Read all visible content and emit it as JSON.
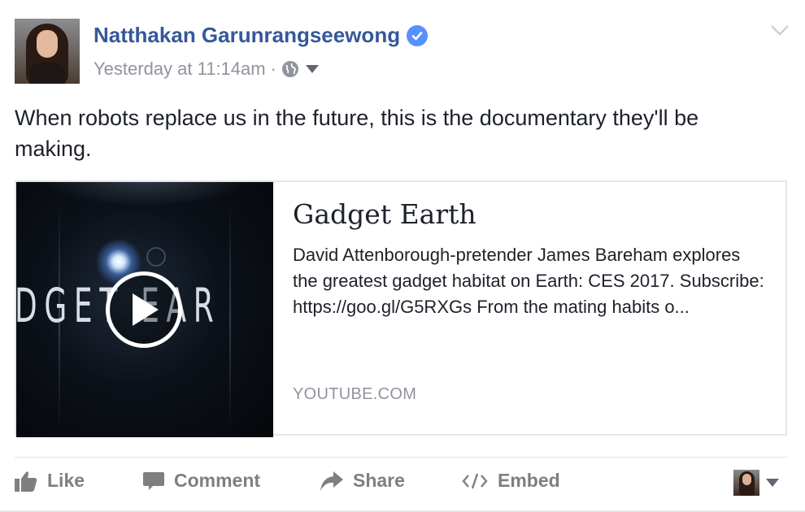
{
  "post": {
    "author": "Natthakan Garunrangseewong",
    "timestamp": "Yesterday at 11:14am",
    "meta_separator": "·",
    "text_line1": "When robots replace us in the future, this is the documentary they'll be",
    "text_line2": "making."
  },
  "link_card": {
    "title": "Gadget Earth",
    "description": "David Attenborough-pretender James Bareham explores the greatest gadget habitat on Earth: CES 2017. Subscribe: https://goo.gl/G5RXGs From the mating habits o...",
    "domain": "YOUTUBE.COM",
    "thumbnail_text": "DGET EAR"
  },
  "actions": {
    "like": "Like",
    "comment": "Comment",
    "share": "Share",
    "embed": "Embed"
  },
  "icons": {
    "verified": "verified-badge-icon",
    "audience": "globe-icon",
    "audience_menu": "caret-down-icon",
    "post_options": "chevron-down-icon",
    "play": "play-icon",
    "like": "thumbs-up-icon",
    "comment": "speech-bubble-icon",
    "share": "share-arrow-icon",
    "embed": "code-brackets-icon",
    "reactor_menu": "caret-down-icon"
  },
  "colors": {
    "author_link": "#365899",
    "verified_badge": "#5890ff",
    "muted_text": "#90949c",
    "action_text": "#7f7f7f",
    "body_text": "#1d2129"
  }
}
